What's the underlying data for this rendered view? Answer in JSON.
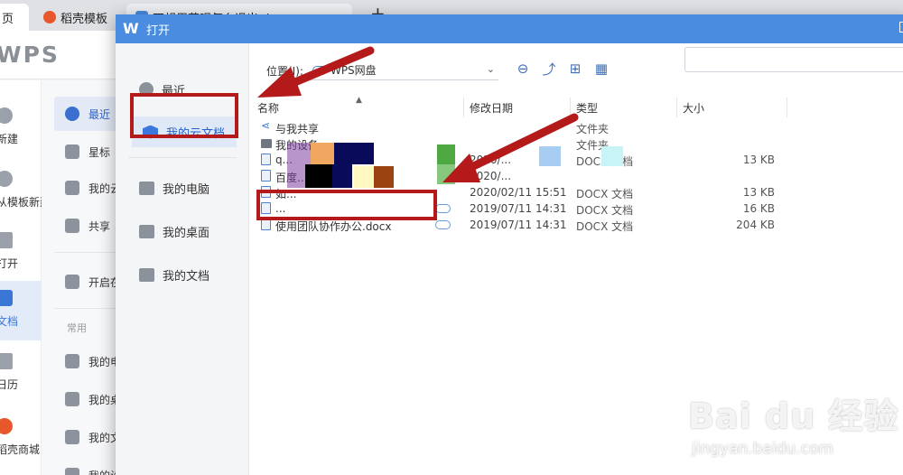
{
  "browser_tabs": [
    {
      "label": "页",
      "icon": "home-icon"
    },
    {
      "label": "稻壳模板",
      "icon": "docer-icon",
      "color": "#e8572c"
    },
    {
      "label": "不想用花呗怎么退出.docx",
      "icon": "word-doc-icon",
      "color": "#4a8ce0"
    }
  ],
  "app": {
    "logo_text": "WPS",
    "rail": [
      "新建",
      "从模板新建",
      "打开",
      "文档",
      "日历",
      "稻壳商城"
    ],
    "panel": {
      "items": [
        "最近",
        "星标",
        "我的云文档",
        "共享",
        "开启在线文档"
      ],
      "section_heading": "常用",
      "common": [
        "我的电脑",
        "我的桌面",
        "我的文档",
        "我的设备"
      ]
    }
  },
  "dialog": {
    "title": "打开",
    "sidebar": [
      "最近",
      "我的云文档",
      "我的电脑",
      "我的桌面",
      "我的文档"
    ],
    "location_label": "位置(I):",
    "location_value": "WPS网盘",
    "columns": {
      "name": "名称",
      "date": "修改日期",
      "type": "类型",
      "size": "大小"
    },
    "rows": [
      {
        "name": "与我共享",
        "date": "",
        "type": "文件夹",
        "size": "",
        "icon": "share-icon",
        "sync": ""
      },
      {
        "name": "我的设备",
        "date": "",
        "type": "文件夹",
        "size": "",
        "icon": "device-icon",
        "sync": ""
      },
      {
        "name": "q...",
        "date": "2020/...",
        "type": "DOCX 文档",
        "size": "13 KB",
        "icon": "word-file-icon",
        "sync": "synced"
      },
      {
        "name": "百度...",
        "date": "2020/...",
        "type": "",
        "size": "",
        "icon": "word-file-icon",
        "sync": ""
      },
      {
        "name": "如...",
        "date": "2020/02/11 15:51",
        "type": "DOCX 文档",
        "size": "13 KB",
        "icon": "word-file-icon",
        "sync": ""
      },
      {
        "name": "...",
        "date": "2019/07/11 14:31",
        "type": "DOCX 文档",
        "size": "16 KB",
        "icon": "word-file-icon",
        "sync": "cloud"
      },
      {
        "name": "使用团队协作办公.docx",
        "date": "2019/07/11 14:31",
        "type": "DOCX 文档",
        "size": "204 KB",
        "icon": "word-file-icon",
        "sync": "cloud"
      }
    ]
  },
  "watermark": {
    "main": "Bai du 经验",
    "sub": "jingyan.baidu.com"
  },
  "colors": {
    "accent": "#4a8ce0",
    "annotation": "#b51a1a"
  }
}
